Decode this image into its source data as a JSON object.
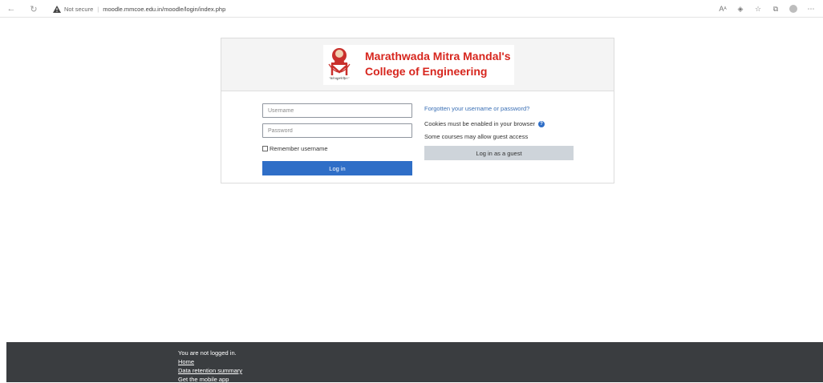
{
  "browser": {
    "security_label": "Not secure",
    "url": "moodle.mmcoe.edu.in/moodle/login/index.php",
    "icons": [
      "back-icon",
      "refresh-icon",
      "warning-icon",
      "read-aloud-icon",
      "tracking-icon",
      "favorites-icon",
      "collections-icon",
      "profile-icon",
      "more-icon"
    ]
  },
  "logo": {
    "line1": "Marathwada Mitra Mandal's",
    "line2": "College of Engineering",
    "motto": "\"केले बहुतांचे हित !\""
  },
  "login": {
    "username_placeholder": "Username",
    "password_placeholder": "Password",
    "remember_label": "Remember username",
    "login_button": "Log in"
  },
  "side": {
    "forgot_link": "Forgotten your username or password?",
    "cookies_text": "Cookies must be enabled in your browser",
    "guest_text": "Some courses may allow guest access",
    "guest_button": "Log in as a guest"
  },
  "footer": {
    "status": "You are not logged in.",
    "links": [
      "Home",
      "Data retention summary",
      "Get the mobile app"
    ]
  },
  "colors": {
    "primary": "#2f6ec7",
    "brand_red": "#d7261e",
    "footer_bg": "#3a3d40",
    "guest_button_bg": "#ced4da"
  }
}
